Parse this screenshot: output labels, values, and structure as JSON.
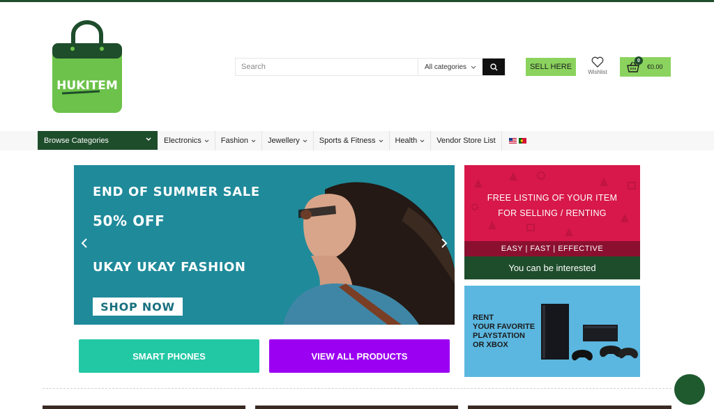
{
  "brand": {
    "logo_text": "HUKITEM",
    "primary_color": "#1e4d2b",
    "accent_color": "#8bd35e"
  },
  "header": {
    "search_placeholder": "Search",
    "category_selected": "All categories",
    "sell_label": "SELL HERE",
    "wishlist_label": "Wishlist",
    "cart_count": "0",
    "cart_total": "€0.00"
  },
  "nav": {
    "browse_label": "Browse Categories",
    "items": [
      {
        "label": "Electronics",
        "has_dropdown": true
      },
      {
        "label": "Fashion",
        "has_dropdown": true
      },
      {
        "label": "Jewellery",
        "has_dropdown": true
      },
      {
        "label": "Sports & Fitness",
        "has_dropdown": true
      },
      {
        "label": "Health",
        "has_dropdown": true
      },
      {
        "label": "Vendor Store List",
        "has_dropdown": false
      }
    ],
    "languages": [
      "English (US flag)",
      "Portuguese (PT flag)"
    ]
  },
  "hero": {
    "line1": "END OF SUMMER SALE",
    "line2": "50% OFF",
    "line3": "UKAY UKAY FASHION",
    "cta": "SHOP NOW",
    "color": "#1f8a9a"
  },
  "promo": {
    "line1": "FREE LISTING OF YOUR ITEM",
    "line2": "FOR SELLING / RENTING",
    "band": "EASY | FAST | EFFECTIVE",
    "footer": "You can be interested",
    "color": "#d8184a"
  },
  "rent": {
    "lines": [
      "RENT",
      "YOUR FAVORITE",
      "PLAYSTATION",
      "OR XBOX"
    ],
    "color": "#5bb7e0"
  },
  "buttons": {
    "phones": "SMART PHONES",
    "products": "VIEW ALL PRODUCTS",
    "phones_color": "#22c8a4",
    "products_color": "#9b00f2"
  }
}
